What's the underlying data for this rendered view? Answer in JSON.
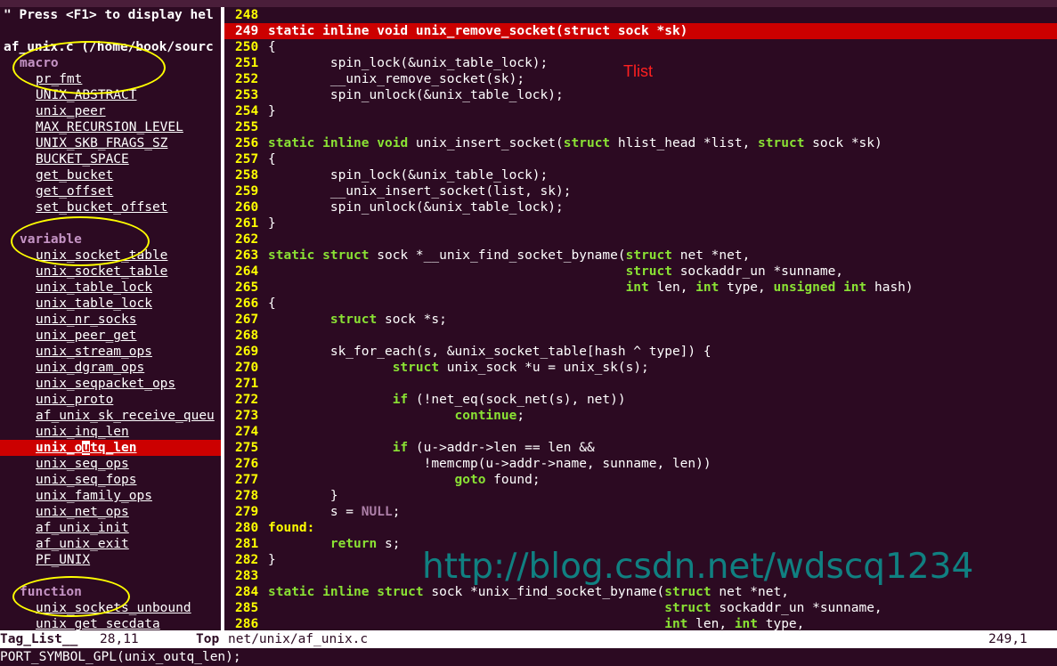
{
  "left": {
    "help": "\" Press <F1> to display hel",
    "file": "af_unix.c (/home/book/sourc",
    "groups": {
      "macro": "macro",
      "variable": "variable",
      "function": "function"
    },
    "macros": [
      "pr_fmt",
      "UNIX_ABSTRACT",
      "unix_peer",
      "MAX_RECURSION_LEVEL",
      "UNIX_SKB_FRAGS_SZ",
      "BUCKET_SPACE",
      "get_bucket",
      "get_offset",
      "set_bucket_offset"
    ],
    "variables": [
      "unix_socket_table",
      "unix_socket_table",
      "unix_table_lock",
      "unix_table_lock",
      "unix_nr_socks",
      "unix_peer_get",
      "unix_stream_ops",
      "unix_dgram_ops",
      "unix_seqpacket_ops",
      "unix_proto",
      "af_unix_sk_receive_queu",
      "unix_inq_len"
    ],
    "selected": {
      "pre": "unix_o",
      "cursor": "u",
      "post": "tq_len"
    },
    "variables_after": [
      "unix_seq_ops",
      "unix_seq_fops",
      "unix_family_ops",
      "unix_net_ops",
      "af_unix_init",
      "af_unix_exit",
      "PF_UNIX"
    ],
    "functions": [
      "unix_sockets_unbound",
      "unix_get_secdata"
    ]
  },
  "code": {
    "lines": [
      {
        "n": "248",
        "t": ""
      },
      {
        "n": "249",
        "t": "static inline void unix_remove_socket(struct sock *sk)"
      },
      {
        "n": "250",
        "t": "{"
      },
      {
        "n": "251",
        "t": "        spin_lock(&unix_table_lock);"
      },
      {
        "n": "252",
        "t": "        __unix_remove_socket(sk);"
      },
      {
        "n": "253",
        "t": "        spin_unlock(&unix_table_lock);"
      },
      {
        "n": "254",
        "t": "}"
      },
      {
        "n": "255",
        "t": ""
      },
      {
        "n": "256",
        "t": "static inline void unix_insert_socket(struct hlist_head *list, struct sock *sk)"
      },
      {
        "n": "257",
        "t": "{"
      },
      {
        "n": "258",
        "t": "        spin_lock(&unix_table_lock);"
      },
      {
        "n": "259",
        "t": "        __unix_insert_socket(list, sk);"
      },
      {
        "n": "260",
        "t": "        spin_unlock(&unix_table_lock);"
      },
      {
        "n": "261",
        "t": "}"
      },
      {
        "n": "262",
        "t": ""
      },
      {
        "n": "263",
        "t": "static struct sock *__unix_find_socket_byname(struct net *net,"
      },
      {
        "n": "264",
        "t": "                                              struct sockaddr_un *sunname,"
      },
      {
        "n": "265",
        "t": "                                              int len, int type, unsigned int hash)"
      },
      {
        "n": "266",
        "t": "{"
      },
      {
        "n": "267",
        "t": "        struct sock *s;"
      },
      {
        "n": "268",
        "t": ""
      },
      {
        "n": "269",
        "t": "        sk_for_each(s, &unix_socket_table[hash ^ type]) {"
      },
      {
        "n": "270",
        "t": "                struct unix_sock *u = unix_sk(s);"
      },
      {
        "n": "271",
        "t": ""
      },
      {
        "n": "272",
        "t": "                if (!net_eq(sock_net(s), net))"
      },
      {
        "n": "273",
        "t": "                        continue;"
      },
      {
        "n": "274",
        "t": ""
      },
      {
        "n": "275",
        "t": "                if (u->addr->len == len &&"
      },
      {
        "n": "276",
        "t": "                    !memcmp(u->addr->name, sunname, len))"
      },
      {
        "n": "277",
        "t": "                        goto found;"
      },
      {
        "n": "278",
        "t": "        }"
      },
      {
        "n": "279",
        "t": "        s = NULL;"
      },
      {
        "n": "280",
        "t": "found:"
      },
      {
        "n": "281",
        "t": "        return s;"
      },
      {
        "n": "282",
        "t": "}"
      },
      {
        "n": "283",
        "t": ""
      },
      {
        "n": "284",
        "t": "static inline struct sock *unix_find_socket_byname(struct net *net,"
      },
      {
        "n": "285",
        "t": "                                                   struct sockaddr_un *sunname,"
      },
      {
        "n": "286",
        "t": "                                                   int len, int type,"
      }
    ],
    "highlight_line": "249"
  },
  "annotation": "Tlist",
  "watermark": "http://blog.csdn.net/wdscq1234",
  "status": {
    "left": "Tag_List__",
    "pos": "28,11",
    "top": "Top",
    "file": "net/unix/af_unix.c",
    "right": "249,1"
  },
  "cmdline": "PORT_SYMBOL_GPL(unix_outq_len);",
  "colors": {
    "bg": "#2c0a22",
    "line_number": "#ffff00",
    "keyword": "#8ae234",
    "highlight": "#cc0000",
    "group": "#c594c5",
    "annotation": "#ffff00",
    "watermark": "#0e8a8a"
  }
}
